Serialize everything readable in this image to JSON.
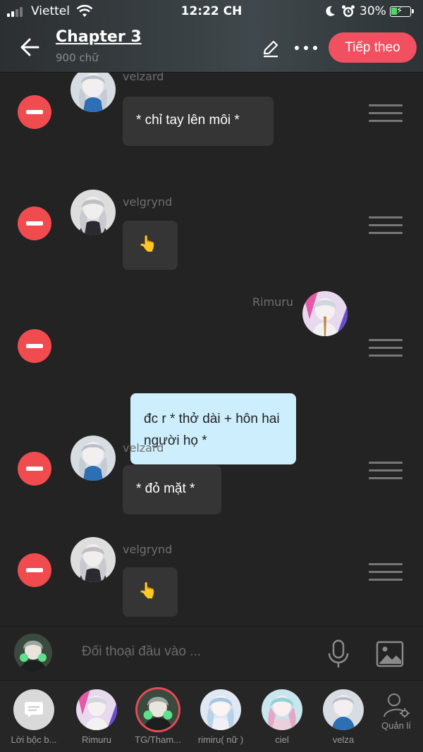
{
  "status_bar": {
    "carrier": "Viettel",
    "time": "12:22 CH",
    "battery": "30%",
    "signal_icon": "signal-icon",
    "wifi_icon": "wifi-icon"
  },
  "header": {
    "title": "Chapter 3",
    "subtitle": "900 chữ",
    "next_label": "Tiếp theo"
  },
  "messages": [
    {
      "speaker": "velzard",
      "text": "* chỉ tay lên môi *",
      "side": "left"
    },
    {
      "speaker": "velgrynd",
      "text": "👆",
      "side": "left"
    },
    {
      "speaker": "Rimuru",
      "text": "đc r * thở dài + hôn hai người họ *",
      "side": "right"
    },
    {
      "speaker": "velzard",
      "text": "* đỏ mặt *",
      "side": "left"
    },
    {
      "speaker": "velgrynd",
      "text": "👆",
      "side": "left"
    }
  ],
  "input": {
    "placeholder": "Đối thoại đầu vào ..."
  },
  "characters": [
    {
      "label": "Lời bộc b..."
    },
    {
      "label": "Rimuru"
    },
    {
      "label": "TG/Tham..."
    },
    {
      "label": "rimiru( nữ )"
    },
    {
      "label": "ciel"
    },
    {
      "label": "velza"
    }
  ],
  "manage_label": "Quản lí",
  "colors": {
    "accent": "#f0505f",
    "delete": "#f04b4e",
    "self_bubble": "#cdeefd",
    "other_bubble": "#353535",
    "background": "#232323"
  }
}
